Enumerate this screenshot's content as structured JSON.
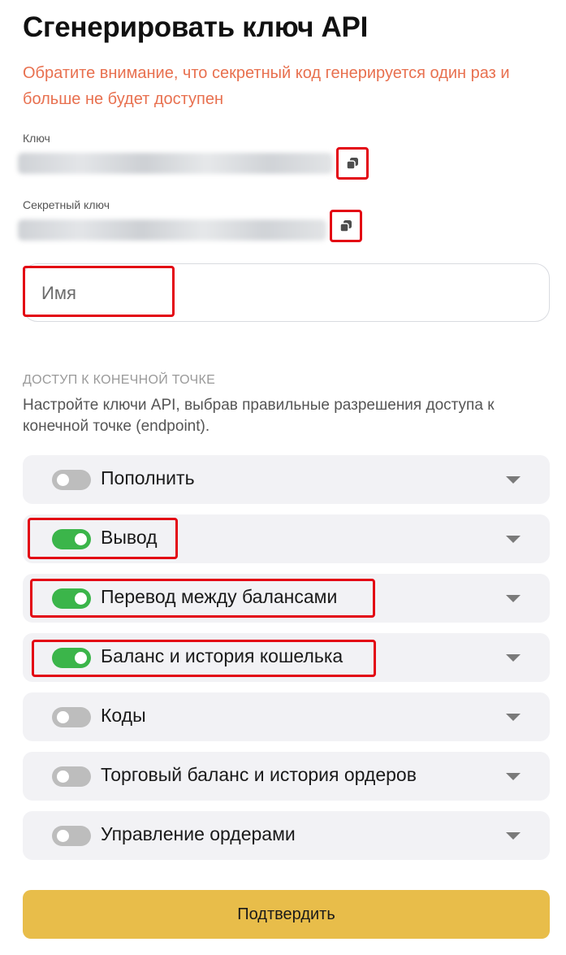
{
  "page": {
    "title": "Сгенерировать ключ API",
    "warning": "Обратите внимание, что секретный код генерируется один раз и больше не будет доступен"
  },
  "key": {
    "label": "Ключ"
  },
  "secret": {
    "label": "Секретный ключ"
  },
  "name_field": {
    "placeholder": "Имя",
    "value": ""
  },
  "endpoint": {
    "title": "ДОСТУП К КОНЕЧНОЙ ТОЧКЕ",
    "description": "Настройте ключи API, выбрав правильные разрешения доступа к конечной точке (endpoint)."
  },
  "permissions": [
    {
      "label": "Пополнить",
      "enabled": false
    },
    {
      "label": "Вывод",
      "enabled": true
    },
    {
      "label": "Перевод между балансами",
      "enabled": true
    },
    {
      "label": "Баланс и история кошелька",
      "enabled": true
    },
    {
      "label": "Коды",
      "enabled": false
    },
    {
      "label": "Торговый баланс и история ордеров",
      "enabled": false
    },
    {
      "label": "Управление ордерами",
      "enabled": false
    }
  ],
  "submit_label": "Подтвердить",
  "colors": {
    "warning": "#e8704f",
    "toggle_on": "#3bb54a",
    "toggle_off": "#bdbdbd",
    "submit": "#e8bd4a",
    "highlight": "#e30613"
  }
}
